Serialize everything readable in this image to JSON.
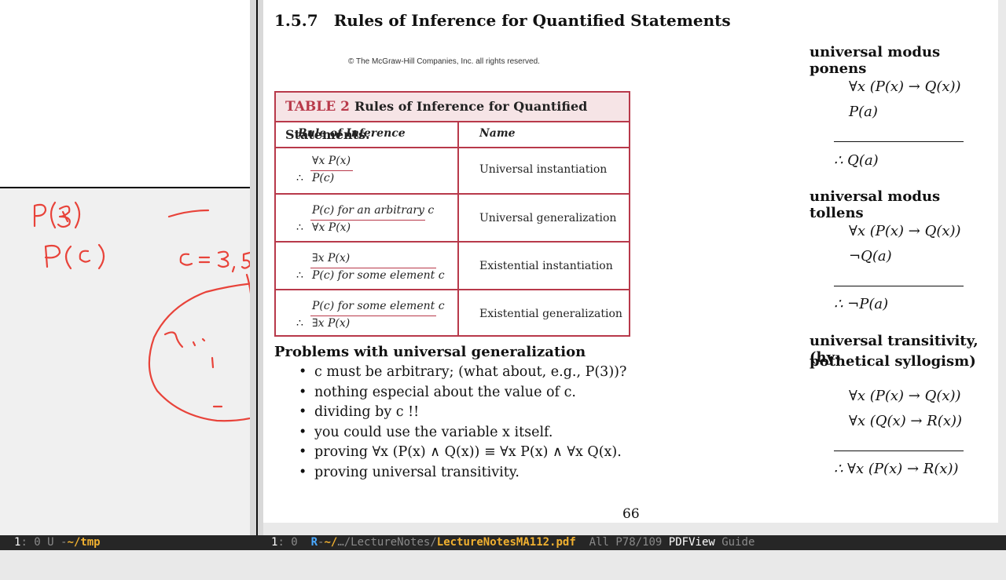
{
  "left_pane": {
    "handwriting": [
      "P(3)",
      "P(c)",
      "c = 3, 5"
    ]
  },
  "document": {
    "section_number": "1.5.7",
    "section_title": "Rules of Inference for Quantified Statements",
    "copyright": "© The McGraw-Hill Companies, Inc. all rights reserved.",
    "table": {
      "caption_label": "TABLE 2",
      "caption_text": "Rules of Inference for Quantified Statements.",
      "col_rule": "Rule of Inference",
      "col_name": "Name",
      "rows": [
        {
          "premise": "∀x P(x)",
          "conclusion": "P(c)",
          "name": "Universal instantiation"
        },
        {
          "premise": "P(c) for an arbitrary c",
          "conclusion": "∀x P(x)",
          "name": "Universal generalization"
        },
        {
          "premise": "∃x P(x)",
          "conclusion": "P(c) for some element c",
          "name": "Existential instantiation"
        },
        {
          "premise": "P(c) for some element c",
          "conclusion": "∃x P(x)",
          "name": "Existential generalization"
        }
      ]
    },
    "problems_title": "Problems with universal generalization",
    "problems": [
      "c must be arbitrary; (what about, e.g., P(3))?",
      "nothing especial about the value of c.",
      "dividing by c !!",
      "you could use the variable x itself.",
      "proving ∀x (P(x) ∧ Q(x)) ≡ ∀x P(x) ∧ ∀x Q(x).",
      "proving universal transitivity."
    ],
    "page_number": "66",
    "rules": [
      {
        "title": "universal modus ponens",
        "lines": [
          "∀x (P(x) → Q(x))",
          "P(a)"
        ],
        "conclusion": "∴ Q(a)"
      },
      {
        "title": "universal modus tollens",
        "lines": [
          "∀x (P(x) → Q(x))",
          "¬Q(a)"
        ],
        "conclusion": "∴ ¬P(a)"
      },
      {
        "title_line1": "universal transitivity, (hy-",
        "title_line2": "pothetical syllogism)",
        "lines": [
          "∀x (P(x) → Q(x))",
          "∀x (Q(x) → R(x))"
        ],
        "conclusion": "∴ ∀x (P(x) → R(x))"
      }
    ]
  },
  "modeline_left": {
    "window_num": "1",
    "rest": ": 0 U -",
    "dir": "~/tmp"
  },
  "modeline_right": {
    "window_num": "1",
    "rest": ": 0  ",
    "buffer_flag": "R",
    "dash": "-",
    "path_home": "~/",
    "path_mid": "…/LectureNotes/",
    "filename": "LectureNotesMA112.pdf",
    "position": "  All P78/109 ",
    "mode": "PDFView",
    "minor": " Guide"
  }
}
